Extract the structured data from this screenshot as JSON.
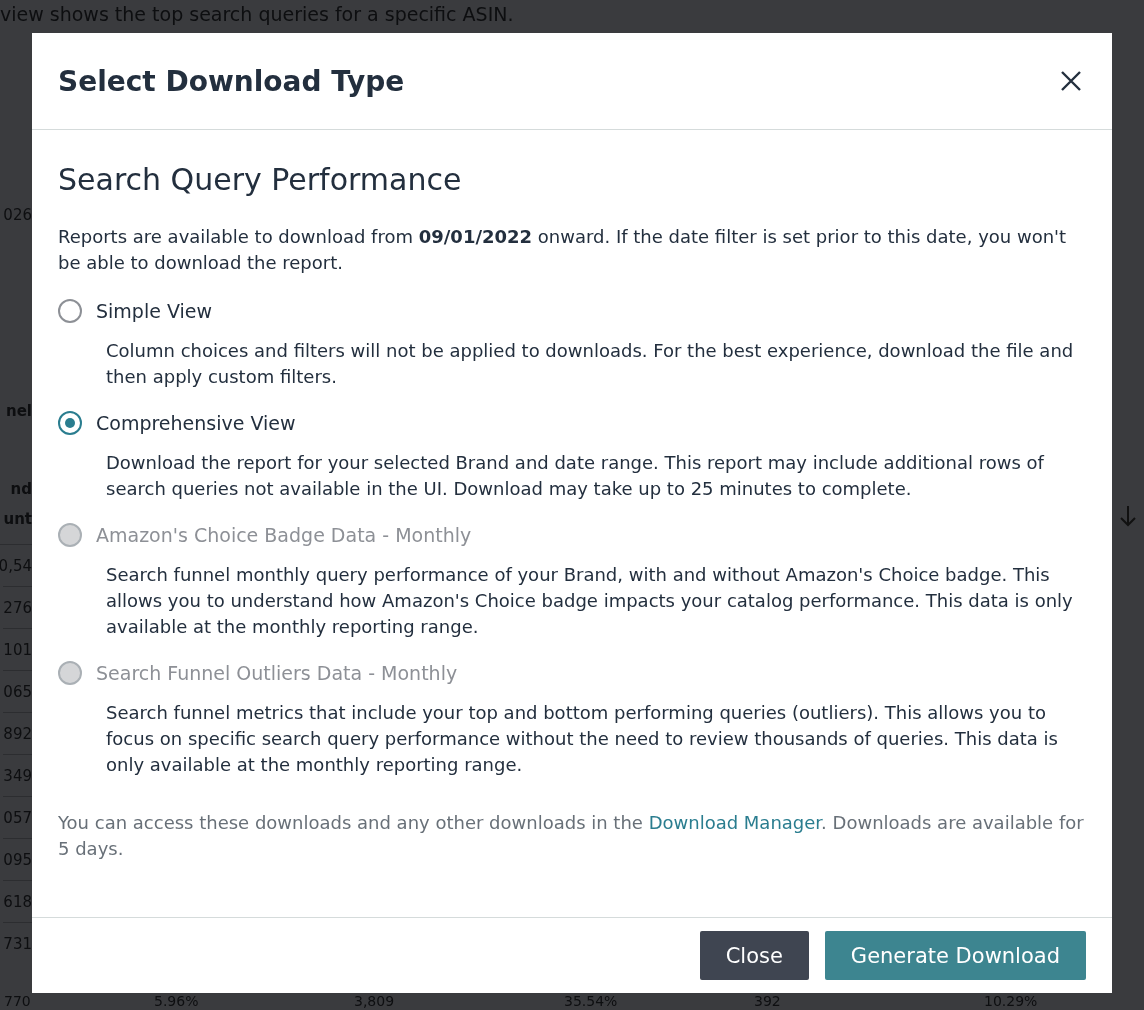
{
  "background_page": {
    "intro_text": "view shows the top search queries for a specific ASIN.",
    "left_fragments": [
      {
        "kind": "field",
        "text": "026"
      },
      {
        "kind": "section",
        "text": "nel"
      },
      {
        "kind": "header",
        "text": "nd"
      },
      {
        "kind": "header",
        "text": "unt"
      },
      {
        "kind": "cell",
        "text": "0,54"
      },
      {
        "kind": "cell",
        "text": "276"
      },
      {
        "kind": "cell",
        "text": "101"
      },
      {
        "kind": "cell",
        "text": "065"
      },
      {
        "kind": "cell",
        "text": "892"
      },
      {
        "kind": "cell",
        "text": "349"
      },
      {
        "kind": "cell",
        "text": "057"
      },
      {
        "kind": "cell",
        "text": "095"
      },
      {
        "kind": "cell",
        "text": "618"
      },
      {
        "kind": "cell",
        "text": "731"
      }
    ],
    "last_row": [
      "770",
      "5.96%",
      "3,809",
      "35.54%",
      "392",
      "10.29%"
    ]
  },
  "dialog": {
    "title": "Select Download Type",
    "section_title": "Search Query Performance",
    "notice": "Reports are available to download from **09/01/2022** onward. If the date filter is set prior to this date, you won't be able to download the report.",
    "options": [
      {
        "label": "Simple View",
        "description": "Column choices and filters will not be applied to downloads. For the best experience, download the file and then apply custom filters.",
        "selected": false,
        "disabled": false
      },
      {
        "label": "Comprehensive View",
        "description": "Download the report for your selected Brand and date range. This report may include additional rows of search queries not available in the UI. Download may take up to 25 minutes to complete.",
        "selected": true,
        "disabled": false
      },
      {
        "label": "Amazon's Choice Badge Data - Monthly",
        "description": "Search funnel monthly query performance of your Brand, with and without Amazon's Choice badge. This allows you to understand how Amazon's Choice badge impacts your catalog performance. This data is only available at the monthly reporting range.",
        "selected": false,
        "disabled": true
      },
      {
        "label": "Search Funnel Outliers Data - Monthly",
        "description": "Search funnel metrics that include your top and bottom performing queries (outliers). This allows you to focus on specific search query performance without the need to review thousands of queries. This data is only available at the monthly reporting range.",
        "selected": false,
        "disabled": true
      }
    ],
    "footer_note": {
      "before": "You can access these downloads and any other downloads in the ",
      "link": "Download Manager",
      "after": ". Downloads are available for 5 days."
    },
    "buttons": [
      {
        "label": "Close",
        "kind": "secondary"
      },
      {
        "label": "Generate Download",
        "kind": "primary"
      }
    ]
  }
}
